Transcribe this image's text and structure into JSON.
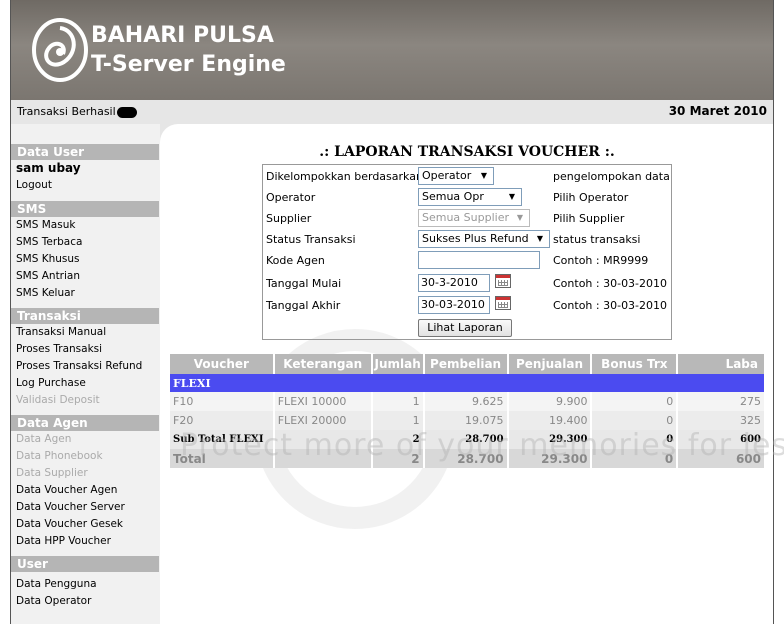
{
  "header": {
    "brand_line1": "BAHARI PULSA",
    "brand_line2": "T-Server Engine"
  },
  "statusbar": {
    "message": "Transaksi Berhasil",
    "date": "30 Maret 2010"
  },
  "sidebar": {
    "sections": {
      "data_user": "Data User",
      "sms": "SMS",
      "transaksi": "Transaksi",
      "data_agen": "Data Agen",
      "user": "User"
    },
    "user_name": "sam ubay",
    "logout": "Logout",
    "sms_items": [
      "SMS Masuk",
      "SMS Terbaca",
      "SMS Khusus",
      "SMS Antrian",
      "SMS Keluar"
    ],
    "transaksi_items": [
      "Transaksi Manual",
      "Proses Transaksi",
      "Proses Transaksi Refund",
      "Log Purchase",
      "Validasi Deposit"
    ],
    "agen_items": [
      "Data Agen",
      "Data Phonebook",
      "Data Supplier",
      "Data Voucher Agen",
      "Data Voucher Server",
      "Data Voucher Gesek",
      "Data HPP Voucher"
    ],
    "user_items": [
      "Data Pengguna",
      "Data Operator"
    ]
  },
  "report": {
    "title": ".: LAPORAN TRANSAKSI VOUCHER :.",
    "form": {
      "group_label": "Dikelompokkan berdasarkan",
      "group_value": "Operator",
      "group_note": "pengelompokan data",
      "operator_label": "Operator",
      "operator_value": "Semua Opr",
      "operator_note": "Pilih Operator",
      "supplier_label": "Supplier",
      "supplier_value": "Semua Supplier",
      "supplier_note": "Pilih Supplier",
      "status_label": "Status Transaksi",
      "status_value": "Sukses Plus Refund",
      "status_note": "status transaksi",
      "kode_label": "Kode Agen",
      "kode_value": "",
      "kode_note": "Contoh : MR9999",
      "mulai_label": "Tanggal Mulai",
      "mulai_value": "30-3-2010",
      "mulai_note": "Contoh : 30-03-2010",
      "akhir_label": "Tanggal Akhir",
      "akhir_value": "30-03-2010",
      "akhir_note": "Contoh : 30-03-2010",
      "submit": "Lihat Laporan"
    },
    "table": {
      "headers": [
        "Voucher",
        "Keterangan",
        "Jumlah",
        "Pembelian",
        "Penjualan",
        "Bonus Trx",
        "Laba"
      ],
      "group": "FLEXI",
      "rows": [
        [
          "F10",
          "FLEXI 10000",
          "1",
          "9.625",
          "9.900",
          "0",
          "275"
        ],
        [
          "F20",
          "FLEXI 20000",
          "1",
          "19.075",
          "19.400",
          "0",
          "325"
        ]
      ],
      "subtotal": [
        "Sub Total FLEXI",
        "",
        "2",
        "28.700",
        "29.300",
        "0",
        "600"
      ],
      "total": [
        "Total",
        "",
        "2",
        "28.700",
        "29.300",
        "0",
        "600"
      ]
    }
  },
  "watermark": "Protect more of your memories for less!"
}
